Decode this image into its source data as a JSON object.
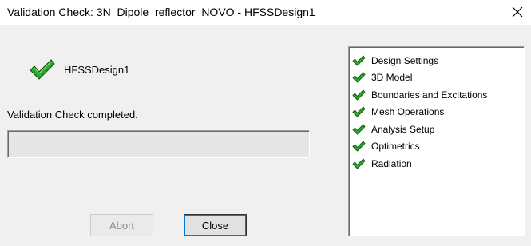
{
  "window": {
    "title": "Validation Check: 3N_Dipole_reflector_NOVO - HFSSDesign1"
  },
  "design": {
    "name": "HFSSDesign1",
    "icon": "green-check-icon"
  },
  "status": {
    "message": "Validation Check completed.",
    "progress": 0
  },
  "buttons": {
    "abort_label": "Abort",
    "abort_enabled": false,
    "close_label": "Close"
  },
  "checks": {
    "items": [
      {
        "label": "Design Settings",
        "status": "passed",
        "icon": "green-check-icon"
      },
      {
        "label": "3D Model",
        "status": "passed",
        "icon": "green-check-icon"
      },
      {
        "label": "Boundaries and Excitations",
        "status": "passed",
        "icon": "green-check-icon"
      },
      {
        "label": "Mesh Operations",
        "status": "passed",
        "icon": "green-check-icon"
      },
      {
        "label": "Analysis Setup",
        "status": "passed",
        "icon": "green-check-icon"
      },
      {
        "label": "Optimetrics",
        "status": "passed",
        "icon": "green-check-icon"
      },
      {
        "label": "Radiation",
        "status": "passed",
        "icon": "green-check-icon"
      }
    ]
  },
  "colors": {
    "check_green": "#2fa82f",
    "check_dark": "#0d5a0d",
    "dialog_bg": "#f0f0f0"
  }
}
